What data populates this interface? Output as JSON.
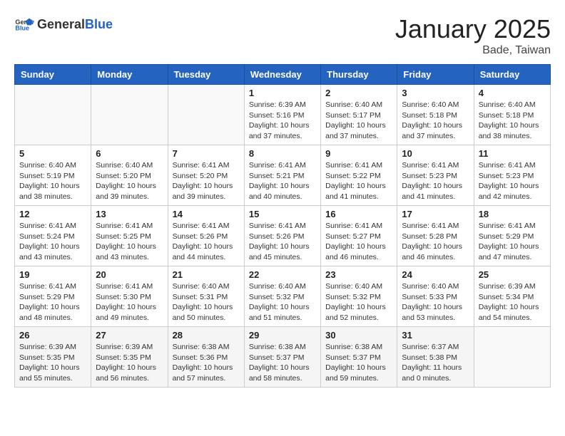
{
  "header": {
    "logo_general": "General",
    "logo_blue": "Blue",
    "month_title": "January 2025",
    "location": "Bade, Taiwan"
  },
  "days_of_week": [
    "Sunday",
    "Monday",
    "Tuesday",
    "Wednesday",
    "Thursday",
    "Friday",
    "Saturday"
  ],
  "weeks": [
    [
      {
        "day": "",
        "info": ""
      },
      {
        "day": "",
        "info": ""
      },
      {
        "day": "",
        "info": ""
      },
      {
        "day": "1",
        "info": "Sunrise: 6:39 AM\nSunset: 5:16 PM\nDaylight: 10 hours and 37 minutes."
      },
      {
        "day": "2",
        "info": "Sunrise: 6:40 AM\nSunset: 5:17 PM\nDaylight: 10 hours and 37 minutes."
      },
      {
        "day": "3",
        "info": "Sunrise: 6:40 AM\nSunset: 5:18 PM\nDaylight: 10 hours and 37 minutes."
      },
      {
        "day": "4",
        "info": "Sunrise: 6:40 AM\nSunset: 5:18 PM\nDaylight: 10 hours and 38 minutes."
      }
    ],
    [
      {
        "day": "5",
        "info": "Sunrise: 6:40 AM\nSunset: 5:19 PM\nDaylight: 10 hours and 38 minutes."
      },
      {
        "day": "6",
        "info": "Sunrise: 6:40 AM\nSunset: 5:20 PM\nDaylight: 10 hours and 39 minutes."
      },
      {
        "day": "7",
        "info": "Sunrise: 6:41 AM\nSunset: 5:20 PM\nDaylight: 10 hours and 39 minutes."
      },
      {
        "day": "8",
        "info": "Sunrise: 6:41 AM\nSunset: 5:21 PM\nDaylight: 10 hours and 40 minutes."
      },
      {
        "day": "9",
        "info": "Sunrise: 6:41 AM\nSunset: 5:22 PM\nDaylight: 10 hours and 41 minutes."
      },
      {
        "day": "10",
        "info": "Sunrise: 6:41 AM\nSunset: 5:23 PM\nDaylight: 10 hours and 41 minutes."
      },
      {
        "day": "11",
        "info": "Sunrise: 6:41 AM\nSunset: 5:23 PM\nDaylight: 10 hours and 42 minutes."
      }
    ],
    [
      {
        "day": "12",
        "info": "Sunrise: 6:41 AM\nSunset: 5:24 PM\nDaylight: 10 hours and 43 minutes."
      },
      {
        "day": "13",
        "info": "Sunrise: 6:41 AM\nSunset: 5:25 PM\nDaylight: 10 hours and 43 minutes."
      },
      {
        "day": "14",
        "info": "Sunrise: 6:41 AM\nSunset: 5:26 PM\nDaylight: 10 hours and 44 minutes."
      },
      {
        "day": "15",
        "info": "Sunrise: 6:41 AM\nSunset: 5:26 PM\nDaylight: 10 hours and 45 minutes."
      },
      {
        "day": "16",
        "info": "Sunrise: 6:41 AM\nSunset: 5:27 PM\nDaylight: 10 hours and 46 minutes."
      },
      {
        "day": "17",
        "info": "Sunrise: 6:41 AM\nSunset: 5:28 PM\nDaylight: 10 hours and 46 minutes."
      },
      {
        "day": "18",
        "info": "Sunrise: 6:41 AM\nSunset: 5:29 PM\nDaylight: 10 hours and 47 minutes."
      }
    ],
    [
      {
        "day": "19",
        "info": "Sunrise: 6:41 AM\nSunset: 5:29 PM\nDaylight: 10 hours and 48 minutes."
      },
      {
        "day": "20",
        "info": "Sunrise: 6:41 AM\nSunset: 5:30 PM\nDaylight: 10 hours and 49 minutes."
      },
      {
        "day": "21",
        "info": "Sunrise: 6:40 AM\nSunset: 5:31 PM\nDaylight: 10 hours and 50 minutes."
      },
      {
        "day": "22",
        "info": "Sunrise: 6:40 AM\nSunset: 5:32 PM\nDaylight: 10 hours and 51 minutes."
      },
      {
        "day": "23",
        "info": "Sunrise: 6:40 AM\nSunset: 5:32 PM\nDaylight: 10 hours and 52 minutes."
      },
      {
        "day": "24",
        "info": "Sunrise: 6:40 AM\nSunset: 5:33 PM\nDaylight: 10 hours and 53 minutes."
      },
      {
        "day": "25",
        "info": "Sunrise: 6:39 AM\nSunset: 5:34 PM\nDaylight: 10 hours and 54 minutes."
      }
    ],
    [
      {
        "day": "26",
        "info": "Sunrise: 6:39 AM\nSunset: 5:35 PM\nDaylight: 10 hours and 55 minutes."
      },
      {
        "day": "27",
        "info": "Sunrise: 6:39 AM\nSunset: 5:35 PM\nDaylight: 10 hours and 56 minutes."
      },
      {
        "day": "28",
        "info": "Sunrise: 6:38 AM\nSunset: 5:36 PM\nDaylight: 10 hours and 57 minutes."
      },
      {
        "day": "29",
        "info": "Sunrise: 6:38 AM\nSunset: 5:37 PM\nDaylight: 10 hours and 58 minutes."
      },
      {
        "day": "30",
        "info": "Sunrise: 6:38 AM\nSunset: 5:37 PM\nDaylight: 10 hours and 59 minutes."
      },
      {
        "day": "31",
        "info": "Sunrise: 6:37 AM\nSunset: 5:38 PM\nDaylight: 11 hours and 0 minutes."
      },
      {
        "day": "",
        "info": ""
      }
    ]
  ]
}
